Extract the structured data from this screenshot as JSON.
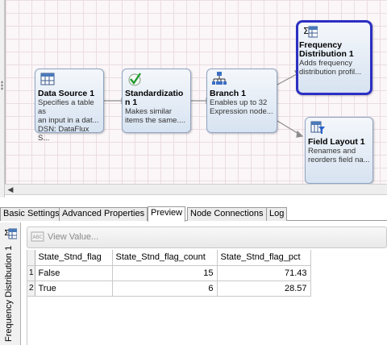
{
  "canvas": {
    "nodes": [
      {
        "id": "data_source",
        "icon": "table-icon",
        "title": "Data Source 1",
        "description": "Specifies a table as\nan input in a dat...\nDSN: DataFlux S..."
      },
      {
        "id": "standardization",
        "icon": "checkmark-icon",
        "title": "Standardizatio\nn 1",
        "description": "Makes similar\nitems the same...."
      },
      {
        "id": "branch",
        "icon": "branch-icon",
        "title": "Branch 1",
        "description": "Enables up to 32\nExpression node..."
      },
      {
        "id": "frequency",
        "icon": "sigma-table-icon",
        "title": "Frequency\nDistribution 1",
        "description": "Adds frequency\ndistribution profil..."
      },
      {
        "id": "field_layout",
        "icon": "table-filter-icon",
        "title": "Field Layout 1",
        "description": "Renames and\nreorders field na..."
      }
    ],
    "selected_node": "frequency"
  },
  "tabs": [
    "Basic Settings",
    "Advanced Properties",
    "Preview",
    "Node Connections",
    "Log"
  ],
  "active_tab": "Preview",
  "side_panel": {
    "label": "Frequency Distribution 1"
  },
  "toolbar": {
    "view_value_label": "View Value..."
  },
  "table": {
    "columns": [
      "State_Stnd_flag",
      "State_Stnd_flag_count",
      "State_Stnd_flag_pct"
    ],
    "rows": [
      {
        "num": "1",
        "flag": "False",
        "count": "15",
        "pct": "71.43"
      },
      {
        "num": "2",
        "flag": "True",
        "count": "6",
        "pct": "28.57"
      }
    ]
  },
  "colors": {
    "selection_border": "#2c2fc2",
    "node_fill": "#d7e3f1",
    "grid_line": "#eadde3"
  }
}
